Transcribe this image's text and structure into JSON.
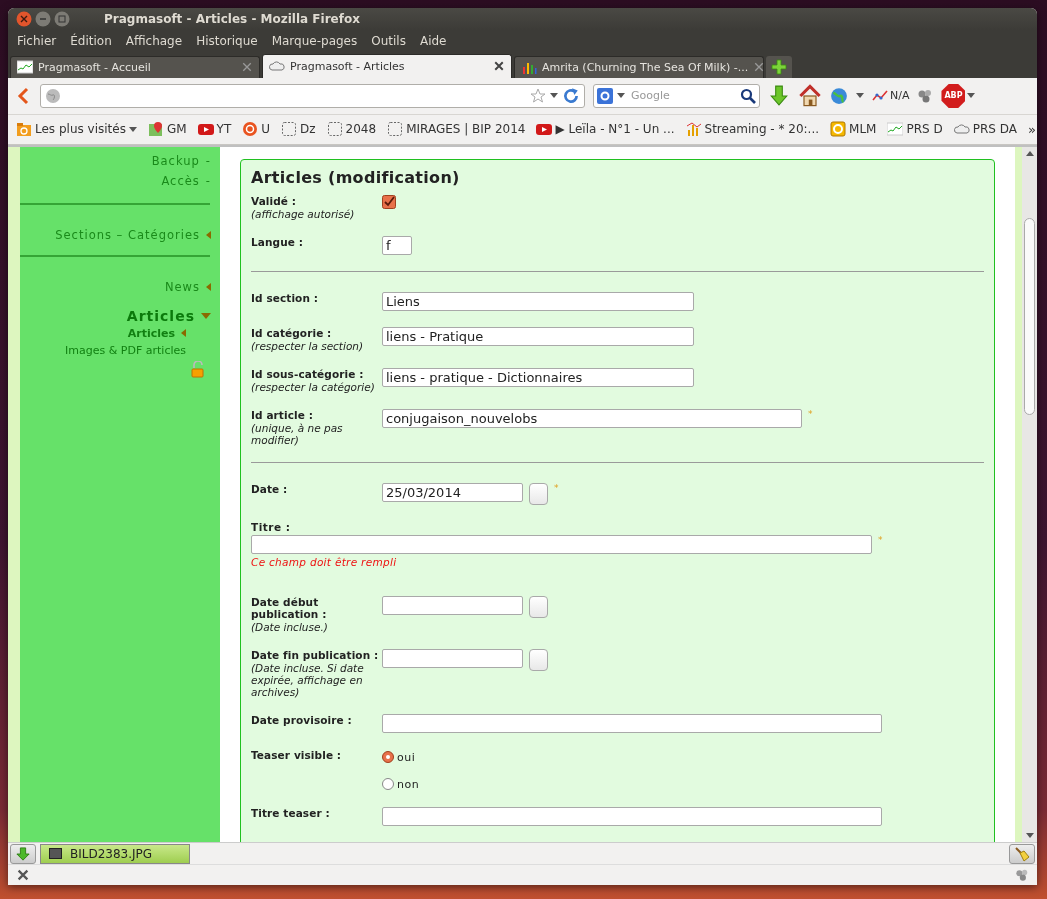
{
  "window": {
    "title": "Pragmasoft - Articles - Mozilla Firefox"
  },
  "menu": [
    "Fichier",
    "Édition",
    "Affichage",
    "Historique",
    "Marque-pages",
    "Outils",
    "Aide"
  ],
  "tabs": [
    {
      "label": "Pragmasoft - Accueil",
      "selected": false,
      "kind": "sparkline"
    },
    {
      "label": "Pragmasoft - Articles",
      "selected": true,
      "kind": "cloud"
    },
    {
      "label": "Amrita (Churning The Sea Of Milk) -...",
      "selected": false,
      "kind": "bars"
    }
  ],
  "navbar": {
    "search_placeholder": "Google",
    "status_label": "N/A",
    "adblock_label": "ABP"
  },
  "bookmarks": [
    {
      "label": "Les plus visités",
      "kind": "folder"
    },
    {
      "label": "GM",
      "kind": "maps"
    },
    {
      "label": "YT",
      "kind": "video"
    },
    {
      "label": "U",
      "kind": "circle"
    },
    {
      "label": "Dz",
      "kind": "blank"
    },
    {
      "label": "2048",
      "kind": "blank"
    },
    {
      "label": "MIRAGES | BIP 2014",
      "kind": "blank"
    },
    {
      "label": "▶ Leïla - N°1 - Un ...",
      "kind": "video"
    },
    {
      "label": "Streaming - * 20:...",
      "kind": "chart"
    },
    {
      "label": "MLM",
      "kind": "badge"
    },
    {
      "label": "PRS D",
      "kind": "sparkline"
    },
    {
      "label": "PRS DA",
      "kind": "cloud"
    }
  ],
  "bookmarks_more": "»",
  "sidebar": [
    {
      "kind": "link",
      "label": "Backup",
      "suffix": "-"
    },
    {
      "kind": "link",
      "label": "Accès",
      "suffix": "-"
    },
    {
      "kind": "divider"
    },
    {
      "kind": "section",
      "label": "Sections – Catégories",
      "expanded": false
    },
    {
      "kind": "divider"
    },
    {
      "kind": "section",
      "label": "News",
      "expanded": false
    },
    {
      "kind": "section",
      "label": "Articles",
      "expanded": true,
      "children": [
        {
          "label": "Articles",
          "selected": true
        },
        {
          "label": "Images & PDF articles",
          "selected": false
        }
      ]
    },
    {
      "kind": "lock"
    }
  ],
  "form": {
    "title": "Articles (modification)",
    "fields": [
      {
        "kind": "checkbox",
        "label": "Validé :",
        "hint": "(affichage autorisé)",
        "checked": true
      },
      {
        "kind": "code",
        "label": "Langue :",
        "value": "f"
      },
      {
        "kind": "divider"
      },
      {
        "kind": "text",
        "label": "Id section :",
        "value": "Liens"
      },
      {
        "kind": "text",
        "label": "Id catégorie :",
        "hint": "(respecter la section)",
        "value": "liens - Pratique"
      },
      {
        "kind": "text",
        "label": "Id sous-catégorie :",
        "hint": "(respecter la catégorie)",
        "value": "liens - pratique - Dictionnaires"
      },
      {
        "kind": "long-text",
        "label": "Id article :",
        "hint": "(unique, à ne pas modifier)",
        "value": "conjugaison_nouvelobs",
        "required_mark": "*"
      },
      {
        "kind": "divider"
      },
      {
        "kind": "date",
        "label": "Date :",
        "value": "25/03/2014",
        "required_mark": "*"
      },
      {
        "kind": "stacked",
        "label": "Titre :",
        "required_mark": "*",
        "error": "Ce champ doit être rempli"
      },
      {
        "kind": "date",
        "label": "Date début publication :",
        "hint": "(Date incluse.)"
      },
      {
        "kind": "date",
        "label": "Date fin publication :",
        "hint": "(Date incluse. Si date expirée, affichage en archives)"
      },
      {
        "kind": "wide-text",
        "label": "Date provisoire :"
      },
      {
        "kind": "radio",
        "label": "Teaser visible :",
        "options": [
          {
            "label": "oui",
            "selected": true
          },
          {
            "label": "non",
            "selected": false
          }
        ]
      },
      {
        "kind": "wide-text",
        "label": "Titre teaser :"
      }
    ]
  },
  "downloads": [
    {
      "label": "BILD2383.JPG"
    }
  ]
}
